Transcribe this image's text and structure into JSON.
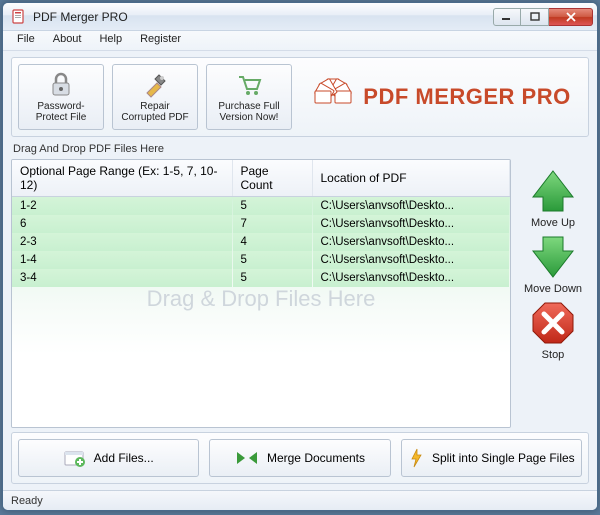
{
  "window": {
    "title": "PDF Merger PRO"
  },
  "menu": {
    "file": "File",
    "about": "About",
    "help": "Help",
    "register": "Register"
  },
  "toolbar": {
    "password": "Password-Protect File",
    "repair": "Repair Corrupted PDF",
    "purchase": "Purchase Full Version Now!"
  },
  "brand": "PDF MERGER PRO",
  "drag_hint": "Drag And Drop PDF Files Here",
  "watermark": "Drag & Drop Files Here",
  "columns": {
    "range": "Optional Page Range (Ex: 1-5, 7, 10-12)",
    "count": "Page Count",
    "location": "Location of PDF"
  },
  "rows": [
    {
      "range": "1-2",
      "count": "5",
      "location": "C:\\Users\\anvsoft\\Deskto..."
    },
    {
      "range": "6",
      "count": "7",
      "location": "C:\\Users\\anvsoft\\Deskto..."
    },
    {
      "range": "2-3",
      "count": "4",
      "location": "C:\\Users\\anvsoft\\Deskto..."
    },
    {
      "range": "1-4",
      "count": "5",
      "location": "C:\\Users\\anvsoft\\Deskto..."
    },
    {
      "range": "3-4",
      "count": "5",
      "location": "C:\\Users\\anvsoft\\Deskto..."
    }
  ],
  "side": {
    "moveup": "Move Up",
    "movedown": "Move Down",
    "stop": "Stop"
  },
  "bottom": {
    "add": "Add Files...",
    "merge": "Merge Documents",
    "split": "Split into Single Page Files"
  },
  "status": "Ready"
}
